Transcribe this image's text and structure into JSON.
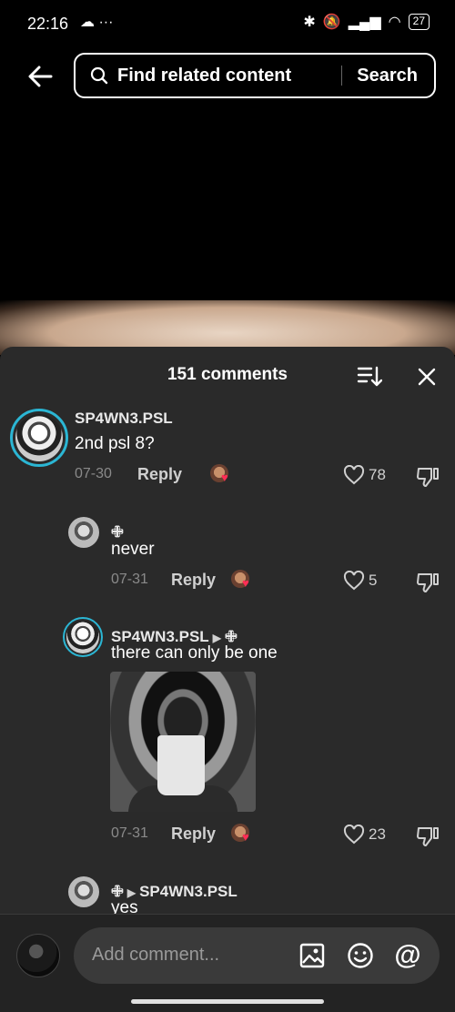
{
  "status": {
    "time": "22:16",
    "left_icons": "☁ ···",
    "battery": "27"
  },
  "search": {
    "placeholder": "Find related content",
    "button": "Search"
  },
  "panel": {
    "title": "151 comments"
  },
  "comments": [
    {
      "user": "SP4WN3.PSL",
      "text": "2nd psl 8?",
      "date": "07-30",
      "reply": "Reply",
      "likes": "78"
    },
    {
      "user": "🜋",
      "text": "never",
      "date": "07-31",
      "reply": "Reply",
      "likes": "5"
    },
    {
      "user": "SP4WN3.PSL",
      "reply_to": "🜋",
      "text": "there can only be one",
      "date": "07-31",
      "reply": "Reply",
      "likes": "23"
    },
    {
      "user": "🜋",
      "reply_to": "SP4WN3.PSL",
      "text": "yes"
    }
  ],
  "composer": {
    "placeholder": "Add comment..."
  },
  "colors": {
    "ring": "#2bb6d4",
    "heart": "#ff2d55",
    "panel": "#2a2a2a"
  }
}
